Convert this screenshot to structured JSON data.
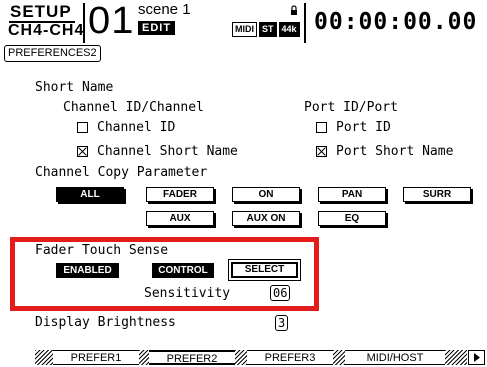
{
  "header": {
    "mode": "SETUP",
    "channels": "CH4-CH4",
    "scene_number": "01",
    "scene_name": "scene 1",
    "edit_badge": "EDIT",
    "badges": [
      "MIDI",
      "ST",
      "44k"
    ],
    "timecode": "00:00:00.00"
  },
  "page_tag": "PREFERENCES2",
  "short_name": {
    "heading": "Short Name",
    "channel_col": "Channel ID/Channel",
    "port_col": "Port ID/Port",
    "options": [
      {
        "label": "Channel ID",
        "checked": false
      },
      {
        "label": "Channel Short Name",
        "checked": true
      },
      {
        "label": "Port ID",
        "checked": false
      },
      {
        "label": "Port Short Name",
        "checked": true
      }
    ]
  },
  "copy_param": {
    "heading": "Channel Copy Parameter",
    "buttons": [
      "ALL",
      "FADER",
      "ON",
      "PAN",
      "SURR",
      "AUX",
      "AUX ON",
      "EQ"
    ],
    "active": "ALL"
  },
  "fader_touch": {
    "heading": "Fader Touch Sense",
    "buttons": [
      "ENABLED",
      "CONTROL",
      "SELECT"
    ],
    "sensitivity_label": "Sensitivity",
    "sensitivity_value": "06"
  },
  "display_brightness": {
    "label": "Display Brightness",
    "value": "3"
  },
  "tabs": [
    "PREFER1",
    "PREFER2",
    "PREFER3",
    "MIDI/HOST"
  ],
  "active_tab": "PREFER2",
  "colors": {
    "highlight": "#e31b1b"
  }
}
